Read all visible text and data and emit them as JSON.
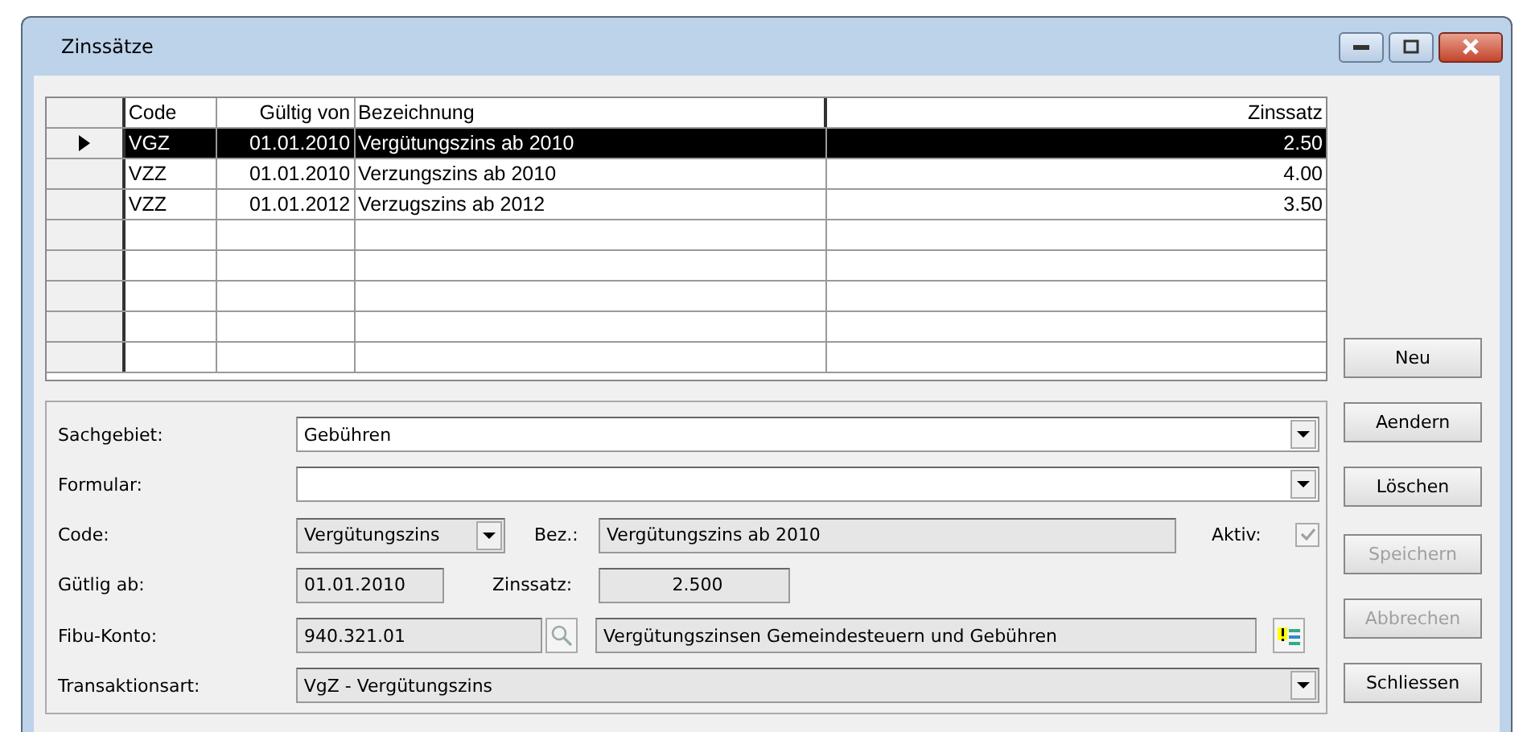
{
  "window": {
    "title": "Zinssätze"
  },
  "table": {
    "columns": [
      "Code",
      "Gültig von",
      "Bezeichnung",
      "Zinssatz"
    ],
    "rows": [
      {
        "selected": true,
        "cells": [
          "VGZ",
          "01.01.2010",
          "Vergütungszins ab 2010",
          "2.50"
        ]
      },
      {
        "selected": false,
        "cells": [
          "VZZ",
          "01.01.2010",
          "Verzungszins ab 2010",
          "4.00"
        ]
      },
      {
        "selected": false,
        "cells": [
          "VZZ",
          "01.01.2012",
          "Verzugszins ab 2012",
          "3.50"
        ]
      }
    ]
  },
  "form": {
    "sachgebiet": {
      "label": "Sachgebiet:",
      "value": "Gebühren"
    },
    "formular": {
      "label": "Formular:"
    },
    "code": {
      "label": "Code:",
      "value": "Vergütungszins"
    },
    "bez": {
      "label": "Bez.:",
      "value": "Vergütungszins ab 2010"
    },
    "aktiv": {
      "label": "Aktiv:",
      "checked": true,
      "disabled": true
    },
    "gueltig_ab": {
      "label": "Gütlig ab:",
      "value": "01.01.2010"
    },
    "zinssatz": {
      "label": "Zinssatz:",
      "value": "2.500"
    },
    "fibu_konto": {
      "label": "Fibu-Konto:",
      "value": "940.321.01",
      "description": "Vergütungszinsen Gemeindesteuern und Gebühren"
    },
    "transaktionsart": {
      "label": "Transaktionsart:",
      "value": "VgZ - Vergütungszins"
    }
  },
  "buttons": [
    {
      "label": "Neu",
      "disabled": false
    },
    {
      "label": "Aendern",
      "disabled": false
    },
    {
      "label": "Löschen",
      "disabled": false
    },
    {
      "label": "Speichern",
      "disabled": true
    },
    {
      "label": "Abbrechen",
      "disabled": true
    },
    {
      "label": "Schliessen",
      "disabled": false
    }
  ]
}
